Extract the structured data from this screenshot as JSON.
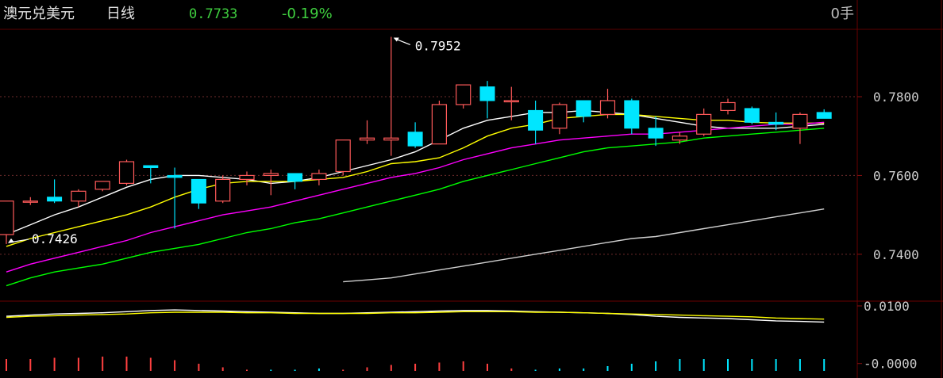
{
  "header": {
    "title": "澳元兑美元",
    "period": "日线",
    "price": "0.7733",
    "change_pct": "-0.19%",
    "volume_label": "0手"
  },
  "chart_data": [
    {
      "type": "candlestick",
      "title": "澳元兑美元 日线",
      "y_ticks": [
        "0.7800",
        "0.7600",
        "0.7400"
      ],
      "ylim": [
        0.7281,
        0.7965
      ],
      "grid": true,
      "annotations": [
        {
          "label": "0.7952",
          "note": "period high"
        },
        {
          "label": "0.7426",
          "note": "period low"
        }
      ],
      "candles": [
        {
          "open": 0.745,
          "high": 0.7535,
          "low": 0.7426,
          "close": 0.7535
        },
        {
          "open": 0.7535,
          "high": 0.7545,
          "low": 0.7525,
          "close": 0.7535
        },
        {
          "open": 0.7545,
          "high": 0.759,
          "low": 0.753,
          "close": 0.7535
        },
        {
          "open": 0.7535,
          "high": 0.7565,
          "low": 0.752,
          "close": 0.756
        },
        {
          "open": 0.7565,
          "high": 0.758,
          "low": 0.756,
          "close": 0.7585
        },
        {
          "open": 0.758,
          "high": 0.764,
          "low": 0.7575,
          "close": 0.7635
        },
        {
          "open": 0.7625,
          "high": 0.7625,
          "low": 0.758,
          "close": 0.762
        },
        {
          "open": 0.76,
          "high": 0.762,
          "low": 0.7465,
          "close": 0.7595
        },
        {
          "open": 0.759,
          "high": 0.759,
          "low": 0.7515,
          "close": 0.753
        },
        {
          "open": 0.7535,
          "high": 0.76,
          "low": 0.753,
          "close": 0.759
        },
        {
          "open": 0.759,
          "high": 0.761,
          "low": 0.7575,
          "close": 0.76
        },
        {
          "open": 0.76,
          "high": 0.7615,
          "low": 0.755,
          "close": 0.7605
        },
        {
          "open": 0.7605,
          "high": 0.7605,
          "low": 0.7565,
          "close": 0.7585
        },
        {
          "open": 0.759,
          "high": 0.7615,
          "low": 0.7575,
          "close": 0.7605
        },
        {
          "open": 0.761,
          "high": 0.769,
          "low": 0.76,
          "close": 0.769
        },
        {
          "open": 0.769,
          "high": 0.774,
          "low": 0.768,
          "close": 0.7695
        },
        {
          "open": 0.769,
          "high": 0.7952,
          "low": 0.765,
          "close": 0.7695
        },
        {
          "open": 0.771,
          "high": 0.7735,
          "low": 0.767,
          "close": 0.7675
        },
        {
          "open": 0.768,
          "high": 0.779,
          "low": 0.768,
          "close": 0.778
        },
        {
          "open": 0.778,
          "high": 0.783,
          "low": 0.777,
          "close": 0.783
        },
        {
          "open": 0.7825,
          "high": 0.784,
          "low": 0.7745,
          "close": 0.779
        },
        {
          "open": 0.779,
          "high": 0.7825,
          "low": 0.774,
          "close": 0.779
        },
        {
          "open": 0.7765,
          "high": 0.779,
          "low": 0.768,
          "close": 0.7715
        },
        {
          "open": 0.772,
          "high": 0.7785,
          "low": 0.7705,
          "close": 0.778
        },
        {
          "open": 0.779,
          "high": 0.779,
          "low": 0.7735,
          "close": 0.775
        },
        {
          "open": 0.7755,
          "high": 0.782,
          "low": 0.7745,
          "close": 0.779
        },
        {
          "open": 0.779,
          "high": 0.7795,
          "low": 0.7705,
          "close": 0.772
        },
        {
          "open": 0.772,
          "high": 0.775,
          "low": 0.7675,
          "close": 0.7695
        },
        {
          "open": 0.769,
          "high": 0.771,
          "low": 0.768,
          "close": 0.77
        },
        {
          "open": 0.7705,
          "high": 0.777,
          "low": 0.77,
          "close": 0.7755
        },
        {
          "open": 0.7765,
          "high": 0.7795,
          "low": 0.7755,
          "close": 0.7785
        },
        {
          "open": 0.777,
          "high": 0.7775,
          "low": 0.773,
          "close": 0.7735
        },
        {
          "open": 0.7735,
          "high": 0.776,
          "low": 0.7715,
          "close": 0.773
        },
        {
          "open": 0.772,
          "high": 0.776,
          "low": 0.768,
          "close": 0.7755
        },
        {
          "open": 0.776,
          "high": 0.7768,
          "low": 0.7745,
          "close": 0.7745
        }
      ],
      "moving_averages": [
        {
          "color": "#ffffff",
          "values": [
            0.745,
            0.7475,
            0.75,
            0.752,
            0.7545,
            0.757,
            0.759,
            0.76,
            0.76,
            0.7595,
            0.759,
            0.758,
            0.7585,
            0.7595,
            0.761,
            0.7625,
            0.764,
            0.766,
            0.769,
            0.772,
            0.774,
            0.775,
            0.776,
            0.776,
            0.7765,
            0.776,
            0.7755,
            0.7745,
            0.7735,
            0.7725,
            0.772,
            0.772,
            0.772,
            0.7725,
            0.773
          ]
        },
        {
          "color": "#ffff00",
          "values": [
            0.742,
            0.744,
            0.7455,
            0.747,
            0.7485,
            0.75,
            0.752,
            0.7545,
            0.7565,
            0.758,
            0.7585,
            0.7585,
            0.7585,
            0.759,
            0.7595,
            0.761,
            0.763,
            0.7635,
            0.7645,
            0.767,
            0.77,
            0.772,
            0.773,
            0.7745,
            0.775,
            0.7755,
            0.7755,
            0.775,
            0.7745,
            0.774,
            0.774,
            0.7735,
            0.7733,
            0.7733,
            0.7733
          ]
        },
        {
          "color": "#ff00ff",
          "values": [
            0.7355,
            0.7375,
            0.739,
            0.7405,
            0.742,
            0.7435,
            0.7455,
            0.747,
            0.7485,
            0.75,
            0.751,
            0.752,
            0.7535,
            0.755,
            0.7565,
            0.758,
            0.7595,
            0.7605,
            0.762,
            0.764,
            0.7655,
            0.767,
            0.768,
            0.769,
            0.7695,
            0.77,
            0.7705,
            0.7705,
            0.771,
            0.7715,
            0.772,
            0.7725,
            0.773,
            0.773,
            0.7735
          ]
        },
        {
          "color": "#00ff00",
          "values": [
            0.732,
            0.734,
            0.7355,
            0.7365,
            0.7375,
            0.739,
            0.7405,
            0.7415,
            0.7425,
            0.744,
            0.7455,
            0.7465,
            0.748,
            0.749,
            0.7505,
            0.752,
            0.7535,
            0.755,
            0.7565,
            0.7585,
            0.76,
            0.7615,
            0.763,
            0.7645,
            0.766,
            0.767,
            0.7675,
            0.768,
            0.7685,
            0.7695,
            0.77,
            0.7705,
            0.771,
            0.7715,
            0.772
          ]
        },
        {
          "color": "#cfcfcf",
          "values": [
            null,
            null,
            null,
            null,
            null,
            null,
            null,
            null,
            null,
            null,
            null,
            null,
            null,
            null,
            0.733,
            0.7335,
            0.734,
            0.735,
            0.736,
            0.737,
            0.738,
            0.739,
            0.74,
            0.741,
            0.742,
            0.743,
            0.744,
            0.7445,
            0.7455,
            0.7465,
            0.7475,
            0.7485,
            0.7495,
            0.7505,
            0.7515
          ]
        }
      ]
    },
    {
      "type": "macd",
      "y_ticks": [
        "0.0100",
        "-0.0000"
      ],
      "ylim": [
        -0.001,
        0.01
      ],
      "dif": [
        0.0082,
        0.0084,
        0.0086,
        0.0087,
        0.0088,
        0.009,
        0.0092,
        0.0093,
        0.0092,
        0.0091,
        0.009,
        0.0089,
        0.0088,
        0.0087,
        0.0087,
        0.0088,
        0.0089,
        0.009,
        0.0091,
        0.0092,
        0.0092,
        0.0091,
        0.009,
        0.0089,
        0.0088,
        0.0087,
        0.0085,
        0.0082,
        0.008,
        0.0079,
        0.0078,
        0.0076,
        0.0074,
        0.0073,
        0.0072
      ],
      "dea": [
        0.008,
        0.0082,
        0.0083,
        0.0084,
        0.0085,
        0.0086,
        0.0088,
        0.0089,
        0.0089,
        0.0089,
        0.0088,
        0.0088,
        0.0087,
        0.0087,
        0.0087,
        0.0087,
        0.0088,
        0.0088,
        0.0089,
        0.009,
        0.009,
        0.009,
        0.0089,
        0.0089,
        0.0088,
        0.0087,
        0.0086,
        0.0085,
        0.0084,
        0.0083,
        0.0082,
        0.0081,
        0.0079,
        0.0078,
        0.0077
      ],
      "hist": [
        0.001,
        0.001,
        0.0011,
        0.0011,
        0.0012,
        0.0012,
        0.0011,
        0.0009,
        0.0006,
        0.0003,
        0.0001,
        -0.0001,
        -0.0001,
        -0.0002,
        0.0001,
        0.0003,
        0.0005,
        0.0006,
        0.0007,
        0.0008,
        0.0006,
        0.0002,
        -0.0001,
        -0.0002,
        -0.0002,
        -0.0004,
        -0.0006,
        -0.0008,
        -0.001,
        -0.001,
        -0.001,
        -0.001,
        -0.001,
        -0.001,
        -0.001
      ]
    }
  ]
}
